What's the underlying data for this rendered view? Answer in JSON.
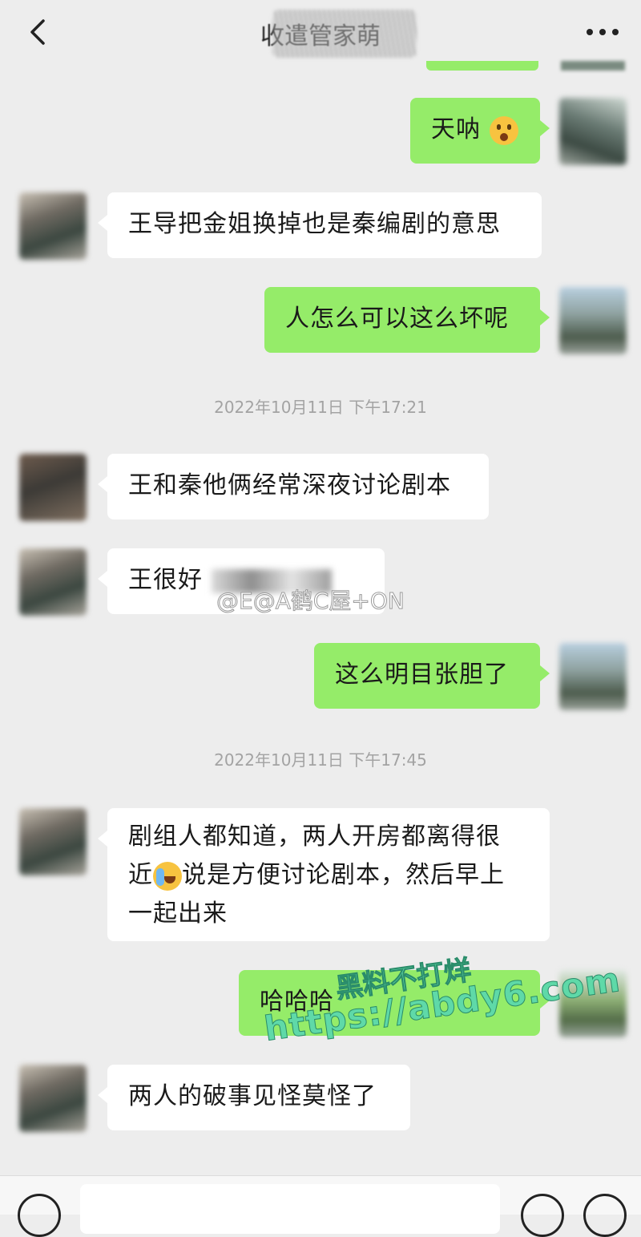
{
  "header": {
    "title": "收遣管家萌",
    "back_icon": "chevron-left-icon",
    "more_icon": "more-dots-icon"
  },
  "colors": {
    "background": "#ededed",
    "outgoing_bubble": "#95ec69",
    "incoming_bubble": "#ffffff",
    "timestamp": "#a3a3a3"
  },
  "messages": [
    {
      "side": "out",
      "text": "天呐",
      "emoji": "shocked-face-emoji"
    },
    {
      "side": "in",
      "text": "王导把金姐换掉也是秦编剧的意思"
    },
    {
      "side": "out",
      "text": "人怎么可以这么坏呢"
    },
    {
      "side": "in",
      "text": "王和秦他俩经常深夜讨论剧本"
    },
    {
      "side": "in",
      "text": "王很好"
    },
    {
      "side": "out",
      "text": "这么明目张胆了"
    },
    {
      "side": "in",
      "text_line1": "剧组人都知道，两人开房都离得很",
      "text_line2_a": "近",
      "emoji": "crying-face-emoji",
      "text_line2_b": "说是方便讨论剧本，然后早上",
      "text_line3": "一起出来"
    },
    {
      "side": "out",
      "text": "哈哈哈"
    },
    {
      "side": "in",
      "text": "两人的破事见怪莫怪了"
    }
  ],
  "timestamps": [
    "2022年10月11日 下午17:21",
    "2022年10月11日 下午17:45"
  ],
  "watermarks": {
    "weibo": "@E@A鹤C屋+ON",
    "site_line1": "黑料不打烊",
    "site_line2": "https://abdy6.com"
  },
  "input": {
    "placeholder": ""
  }
}
